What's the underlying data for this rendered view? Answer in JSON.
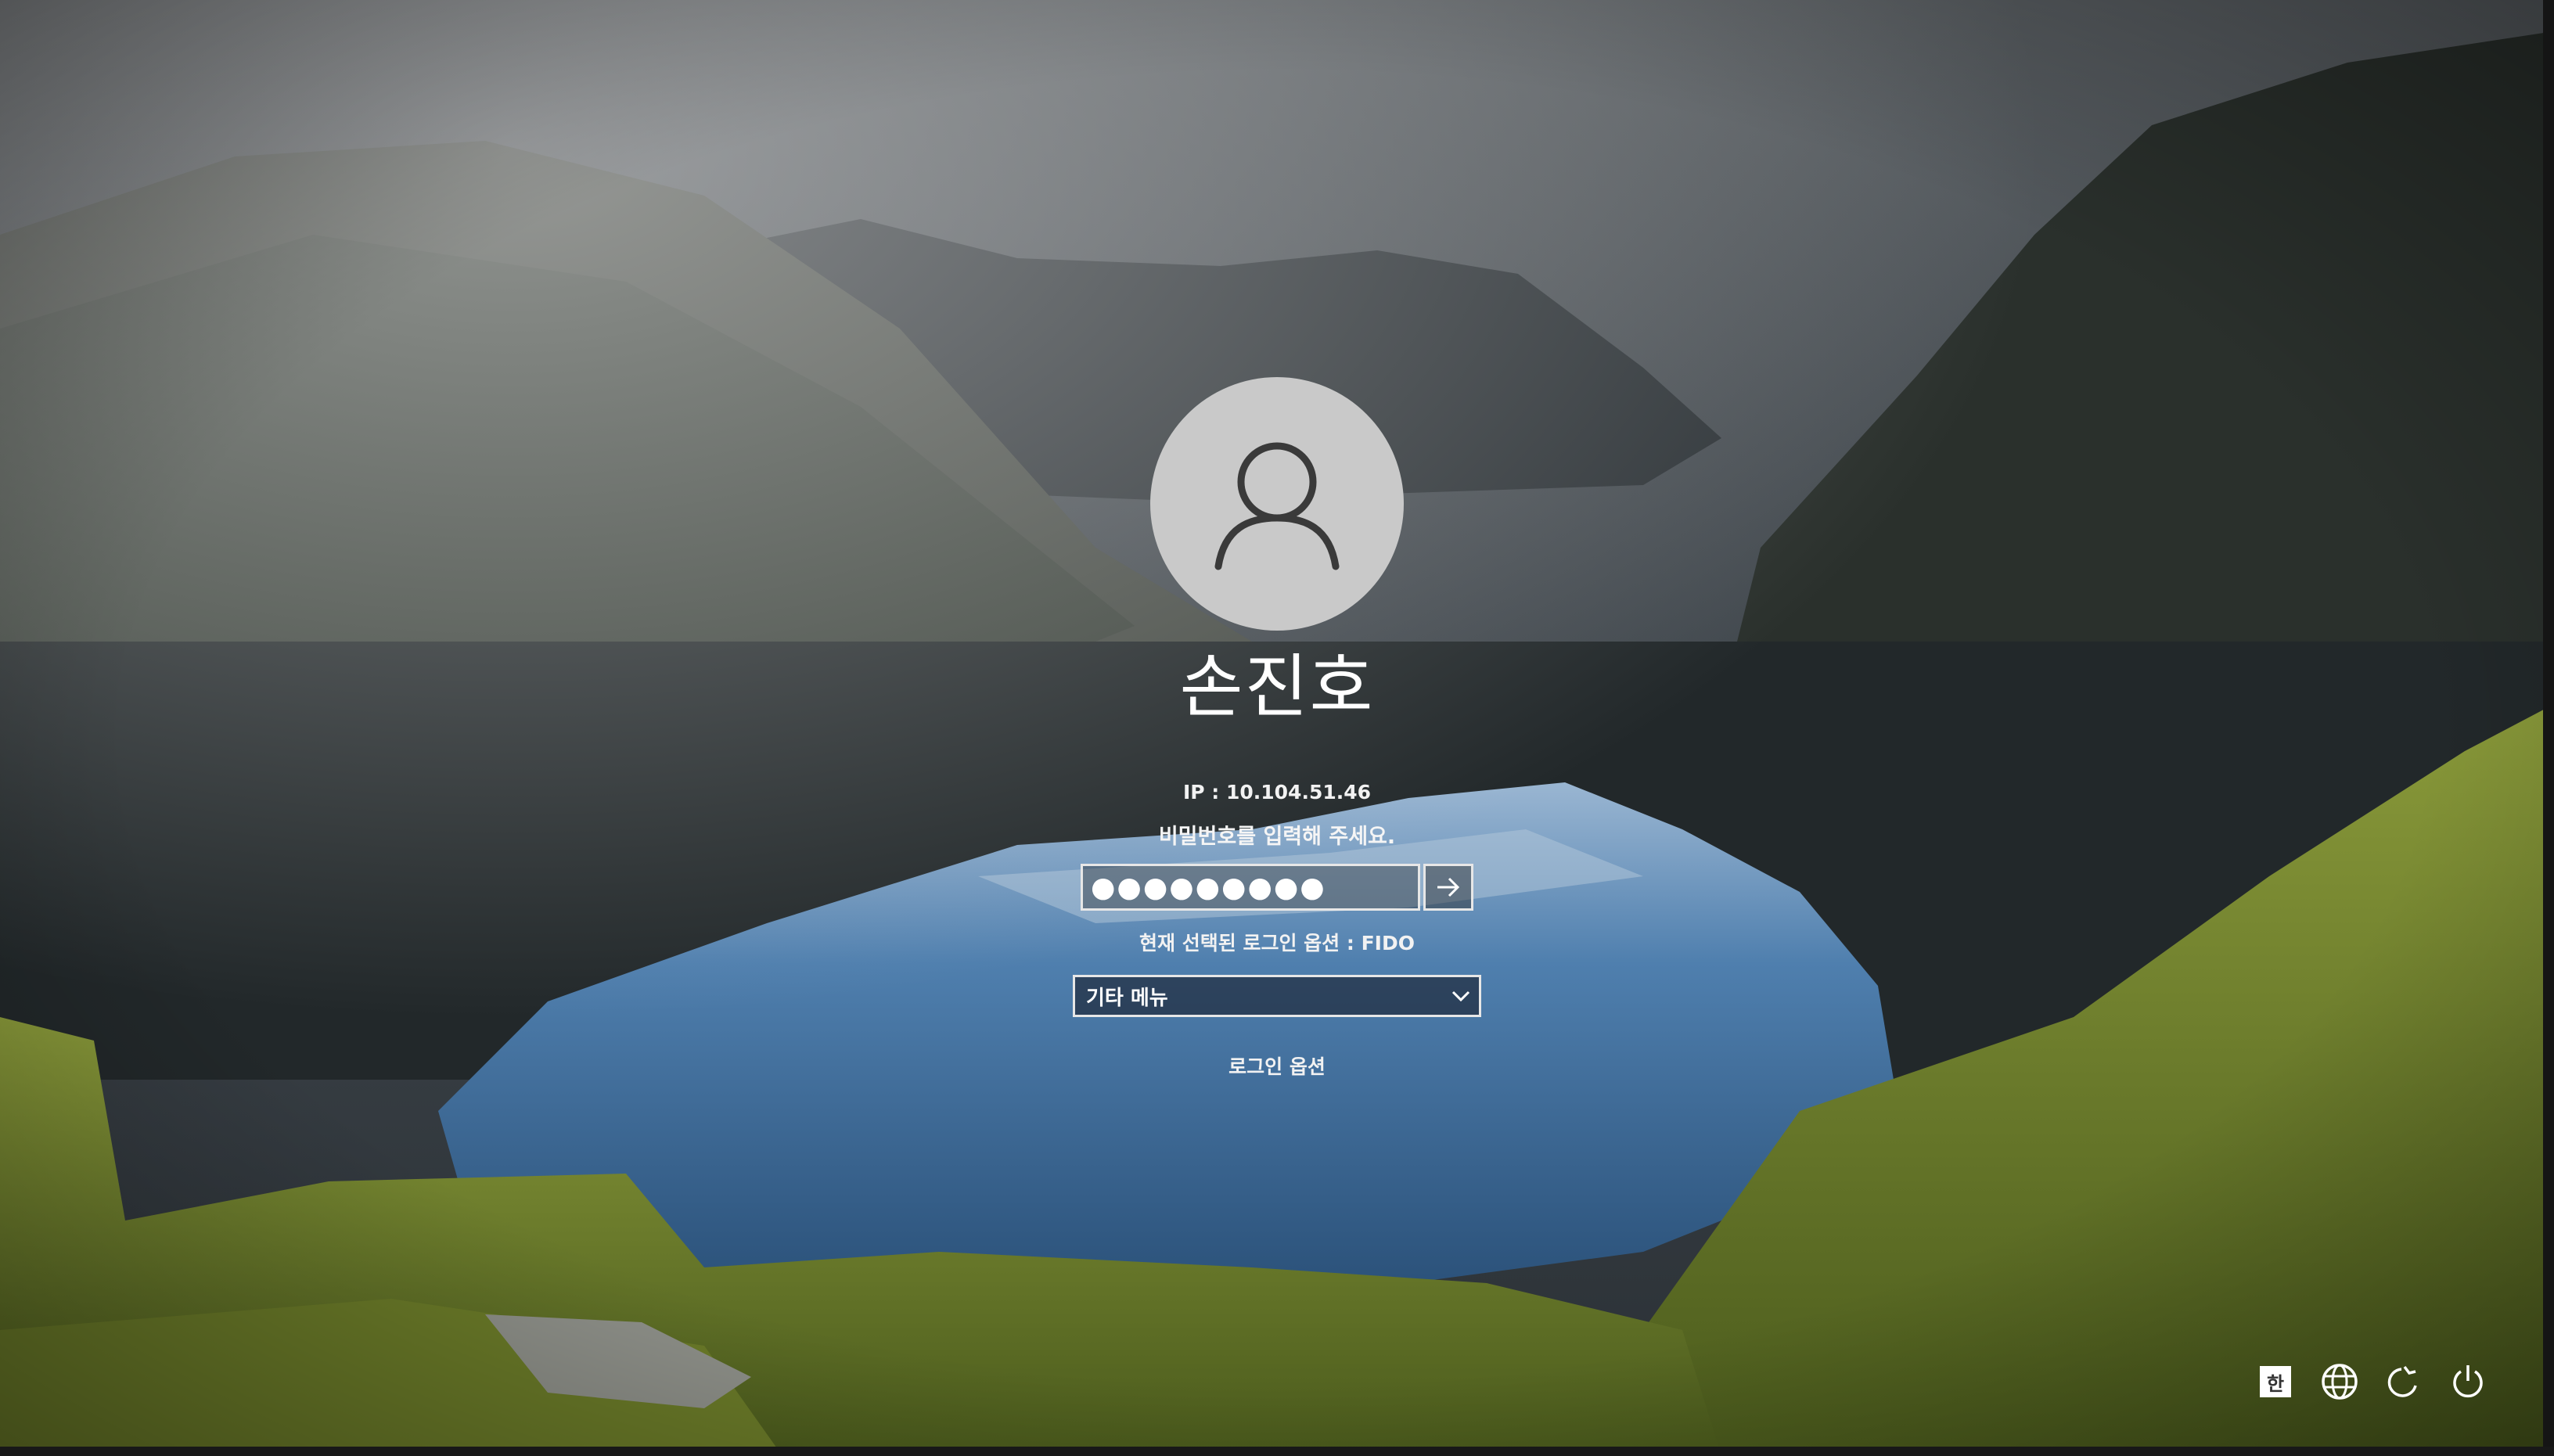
{
  "user": {
    "name": "손진호",
    "ip_text": "IP : 10.104.51.46",
    "prompt": "비밀번호를 입력해 주세요."
  },
  "password": {
    "masked_value": "●●●●●●●●●"
  },
  "login": {
    "current_option": "현재 선택된 로그인 옵션 : FIDO",
    "menu_selected": "기타 메뉴",
    "options_link": "로그인 옵션"
  },
  "tray": {
    "ime_label": "한",
    "icons": [
      "ime-icon",
      "network-icon",
      "accessibility-icon",
      "power-icon"
    ]
  },
  "colors": {
    "field_border": "#e7e7e7",
    "avatar_bg": "#c9c9c9",
    "text": "#ffffff"
  }
}
